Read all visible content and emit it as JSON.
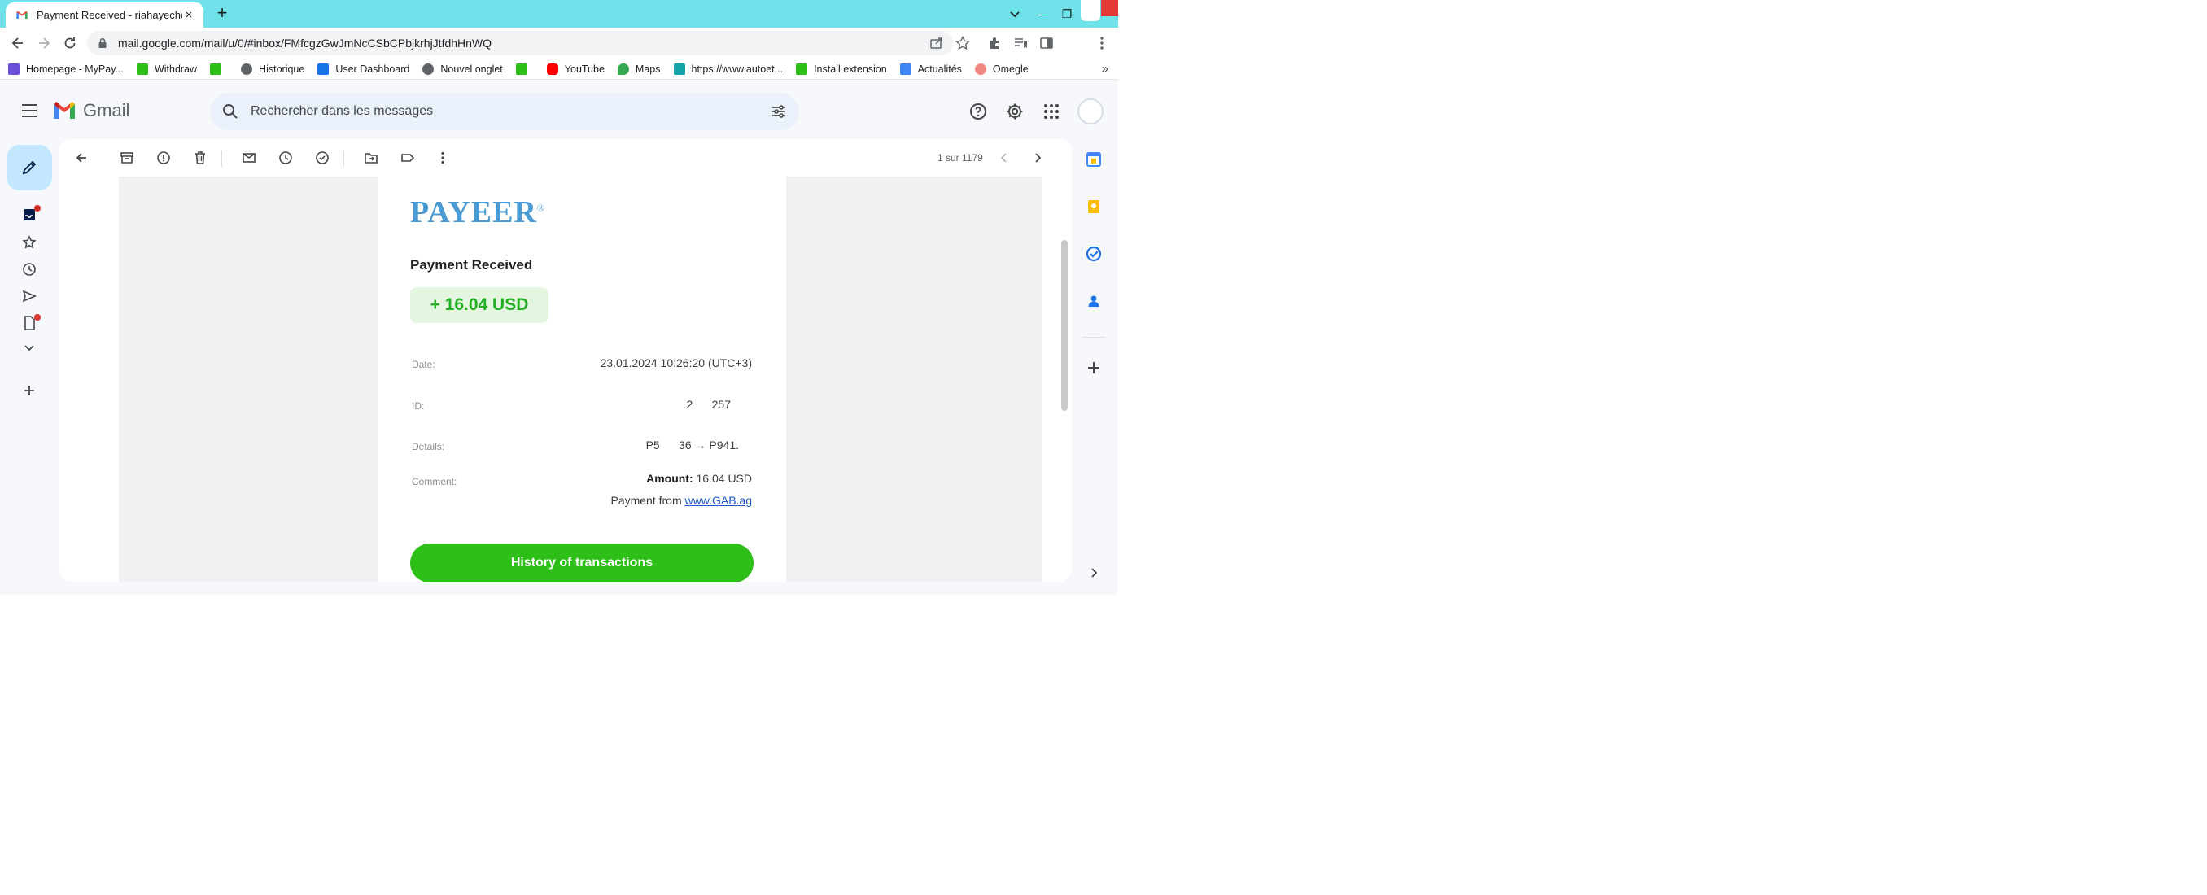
{
  "browser": {
    "tab_title": "Payment Received - riahayechel",
    "tab_close": "×",
    "new_tab": "+",
    "url": "mail.google.com/mail/u/0/#inbox/FMfcgzGwJmNcCSbCPbjkrhjJtfdhHnWQ",
    "window_controls": {
      "minimize": "—",
      "restore": "❐"
    },
    "bookmarks": [
      {
        "label": "Homepage - MyPay...",
        "icon": "mypay-icon",
        "color": "#6b4fd8"
      },
      {
        "label": "Withdraw",
        "icon": "payeer-p-icon",
        "color": "#2ec018"
      },
      {
        "label": "",
        "icon": "payeer-p-icon",
        "color": "#2ec018"
      },
      {
        "label": "Historique",
        "icon": "history-icon",
        "color": "#5f6368"
      },
      {
        "label": "User Dashboard",
        "icon": "dashboard-icon",
        "color": "#1a73e8"
      },
      {
        "label": "Nouvel onglet",
        "icon": "globe-icon",
        "color": "#5f6368"
      },
      {
        "label": "",
        "icon": "payeer-p-icon",
        "color": "#2ec018"
      },
      {
        "label": "YouTube",
        "icon": "youtube-icon",
        "color": "#ff0000"
      },
      {
        "label": "Maps",
        "icon": "maps-icon",
        "color": "#34a853"
      },
      {
        "label": "https://www.autoet...",
        "icon": "site-icon",
        "color": "#12a4a8"
      },
      {
        "label": "Install extension",
        "icon": "payeer-p-icon",
        "color": "#2ec018"
      },
      {
        "label": "Actualités",
        "icon": "news-icon",
        "color": "#4285f4"
      },
      {
        "label": "Omegle",
        "icon": "omegle-icon",
        "color": "#f08a80"
      }
    ],
    "bookmarks_more": "»"
  },
  "gmail": {
    "logo_text": "Gmail",
    "search_placeholder": "Rechercher dans les messages",
    "pager": "1 sur 1179"
  },
  "email": {
    "brand": "PAYEER",
    "brand_mark": "®",
    "heading": "Payment Received",
    "amount_badge": "+ 16.04 USD",
    "rows": {
      "date_label": "Date:",
      "date_value": "23.01.2024 10:26:20 (UTC+3)",
      "id_label": "ID:",
      "id_value": "2      257",
      "details_label": "Details:",
      "details_value": "P5      36 → P941.",
      "comment_label": "Comment:"
    },
    "comment": {
      "amount_label": "Amount:",
      "amount_value": "16.04 USD",
      "from_prefix": "Payment from",
      "from_link": "www.GAB.ag"
    },
    "history_button": "History of transactions"
  },
  "colors": {
    "tab_strip": "#6ee2e8",
    "payeer_blue": "#4a9bd4",
    "amount_green": "#22b022",
    "button_green": "#2ec018",
    "compose_bg": "#c2e7ff",
    "badge_red": "#d93025"
  }
}
